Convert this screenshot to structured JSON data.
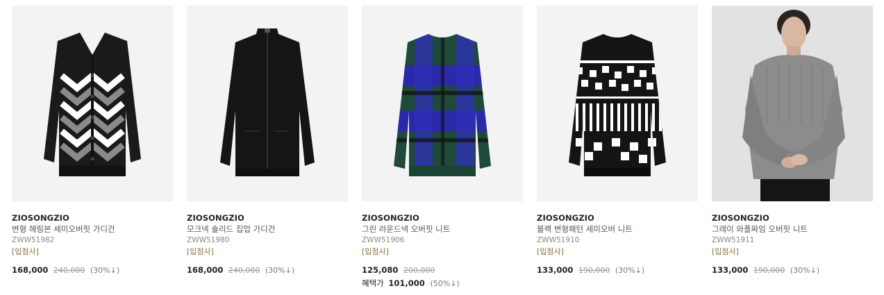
{
  "products": [
    {
      "image_icon": "cardigan-chevron-image",
      "brand": "ZIOSONGZIO",
      "name": "변형 헤링본 세미오버핏 가디건",
      "code": "ZWW51982",
      "vendor_label": "[입점사]",
      "price": "168,000",
      "original_price": "240,000",
      "discount": "(30%↓)"
    },
    {
      "image_icon": "zip-cardigan-image",
      "brand": "ZIOSONGZIO",
      "name": "모크넥 솔리드 집업 가디건",
      "code": "ZWW51980",
      "vendor_label": "[입점사]",
      "price": "168,000",
      "original_price": "240,000",
      "discount": "(30%↓)"
    },
    {
      "image_icon": "green-check-knit-image",
      "brand": "ZIOSONGZIO",
      "name": "그린 라운드넥 오버핏 니트",
      "code": "ZWW51906",
      "vendor_label": "[입점사]",
      "price": "125,080",
      "original_price": "200,000",
      "discount": "",
      "benefit_label": "혜택가",
      "benefit_price": "101,000",
      "benefit_discount": "(50%↓)"
    },
    {
      "image_icon": "black-pattern-knit-image",
      "brand": "ZIOSONGZIO",
      "name": "블랙 변형패턴 세미오버 니트",
      "code": "ZWW51910",
      "vendor_label": "[입점사]",
      "price": "133,000",
      "original_price": "190,000",
      "discount": "(30%↓)"
    },
    {
      "image_icon": "grey-waffle-knit-model-image",
      "brand": "ZIOSONGZIO",
      "name": "그레이 와플짜임 오버핏 니트",
      "code": "ZWW51911",
      "vendor_label": "[입점사]",
      "price": "133,000",
      "original_price": "190,000",
      "discount": "(30%↓)"
    }
  ],
  "colors": {
    "vendor": "#8a6d3b",
    "price": "#222222",
    "original_price": "#999999",
    "background_thumb": "#f3f3f3"
  }
}
